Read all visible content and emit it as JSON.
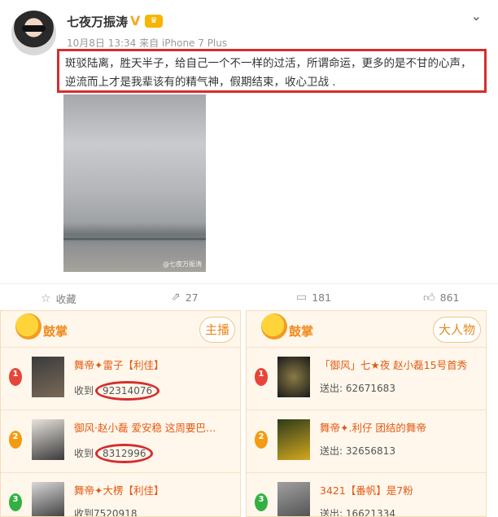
{
  "post": {
    "user_name": "七夜万振涛",
    "vip_glyph": "V",
    "meta": "10月8日 13:34 来自 iPhone 7 Plus",
    "text": "斑驳陆离，胜天半子，给自己一个不一样的过活，所谓命运，更多的是不甘的心声，逆流而上才是我辈该有的精气神，假期结束，收心卫战 .",
    "image_watermark": "@七夜万振涛"
  },
  "actions": {
    "favorite_label": "收藏",
    "share_count": "27",
    "comment_count": "181",
    "like_count": "861"
  },
  "panels": {
    "left": {
      "title": "鼓掌",
      "tag": "主播",
      "rows": [
        {
          "rank": "1",
          "name": "舞帝✦雷子【利佳】",
          "stat_label": "收到",
          "stat_value": "92314076"
        },
        {
          "rank": "2",
          "name": "御风·赵小磊 爱安稳 这周要巴…",
          "stat_label": "收到",
          "stat_value": "8312996"
        },
        {
          "rank": "3",
          "name": "舞帝✦大楞【利佳】",
          "stat_label": "收到",
          "stat_value": "7520918"
        }
      ]
    },
    "right": {
      "title": "鼓掌",
      "tag": "大人物",
      "rows": [
        {
          "rank": "1",
          "name": "「御风」七★夜 赵小磊15号首秀",
          "stat_label": "送出:",
          "stat_value": "62671683"
        },
        {
          "rank": "2",
          "name": "舞帝✦.利仔 团结的舞帝",
          "stat_label": "送出:",
          "stat_value": "32656813"
        },
        {
          "rank": "3",
          "name": "3421【番帆】是7粉",
          "stat_label": "送出:",
          "stat_value": "16621334"
        }
      ]
    }
  }
}
